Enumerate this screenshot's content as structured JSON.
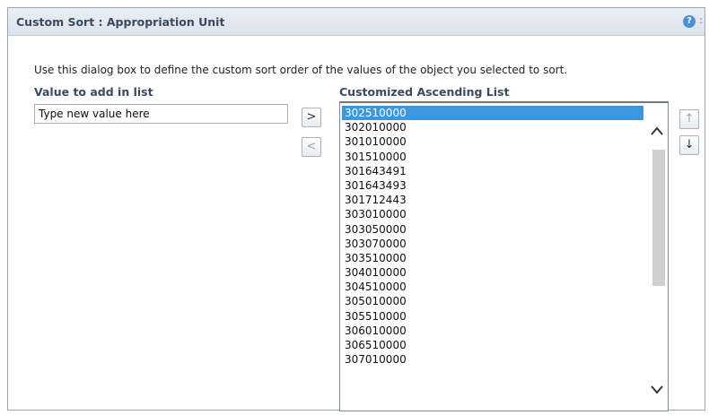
{
  "dialog": {
    "title": "Custom Sort : Appropriation Unit",
    "help": "?",
    "description": "Use this dialog box to define the custom sort order of the values of the object you selected to sort."
  },
  "left": {
    "label": "Value to add in list",
    "input_value": "Type new value here"
  },
  "buttons": {
    "add": ">",
    "remove": "<",
    "up": "↑",
    "down": "↓"
  },
  "right": {
    "label": "Customized Ascending List",
    "selected_index": 0,
    "items": [
      "302510000",
      "302010000",
      "301010000",
      "301510000",
      "301643491",
      "301643493",
      "301712443",
      "303010000",
      "303050000",
      "303070000",
      "303510000",
      "304010000",
      "304510000",
      "305010000",
      "305510000",
      "306010000",
      "306510000",
      "307010000"
    ]
  },
  "scrollbar": {
    "up": "^",
    "down": "v"
  }
}
